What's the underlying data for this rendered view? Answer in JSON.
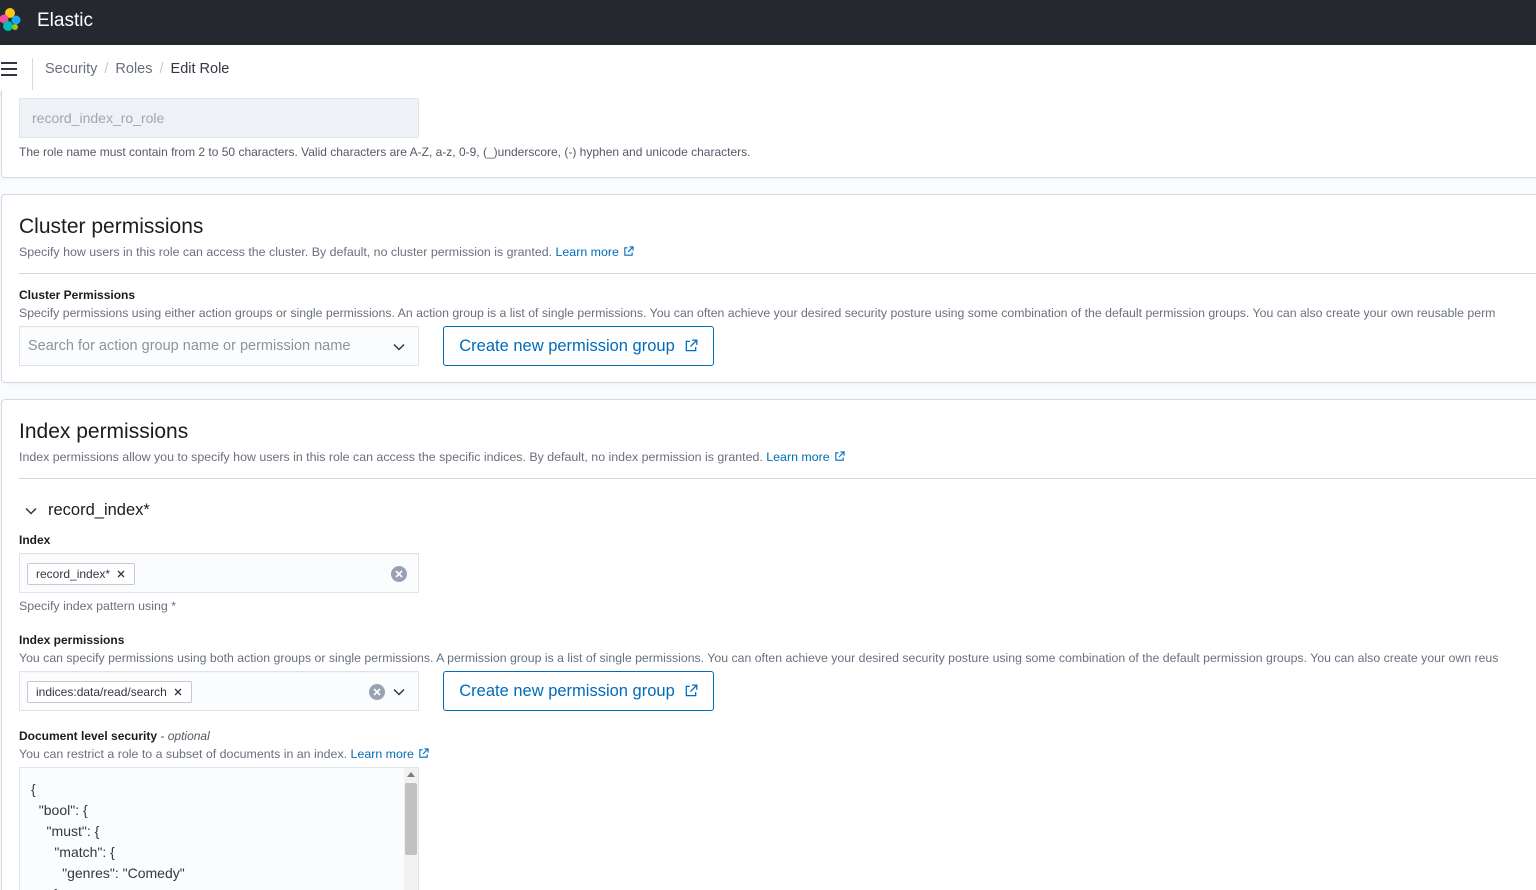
{
  "app": {
    "title": "Elastic"
  },
  "breadcrumbs": {
    "items": [
      "Security",
      "Roles"
    ],
    "current": "Edit Role"
  },
  "role_name": {
    "value": "record_index_ro_role",
    "help": "The role name must contain from 2 to 50 characters. Valid characters are A-Z, a-z, 0-9, (_)underscore, (-) hyphen and unicode characters."
  },
  "cluster": {
    "title": "Cluster permissions",
    "description": "Specify how users in this role can access the cluster. By default, no cluster permission is granted.",
    "learn_more": "Learn more",
    "field_label": "Cluster Permissions",
    "field_help": "Specify permissions using either action groups or single permissions. An action group is a list of single permissions. You can often achieve your desired security posture using some combination of the default permission groups. You can also create your own reusable perm",
    "search_placeholder": "Search for action group name or permission name",
    "create_button": "Create new permission group"
  },
  "index": {
    "title": "Index permissions",
    "description": "Index permissions allow you to specify how users in this role can access the specific indices. By default, no index permission is granted.",
    "learn_more": "Learn more",
    "accordion_label": "record_index*",
    "index_label": "Index",
    "index_pill": "record_index*",
    "index_help": "Specify index pattern using *",
    "perm_label": "Index permissions",
    "perm_help": "You can specify permissions using both action groups or single permissions. A permission group is a list of single permissions. You can often achieve your desired security posture using some combination of the default permission groups. You can also create your own reus",
    "perm_pill": "indices:data/read/search",
    "create_button": "Create new permission group",
    "dls_label": "Document level security",
    "dls_optional": "- optional",
    "dls_help": "You can restrict a role to a subset of documents in an index.",
    "dls_learn_more": "Learn more",
    "dls_code": [
      "{",
      "  \"bool\": {",
      "    \"must\": {",
      "      \"match\": {",
      "        \"genres\": \"Comedy\"",
      "      }"
    ]
  }
}
